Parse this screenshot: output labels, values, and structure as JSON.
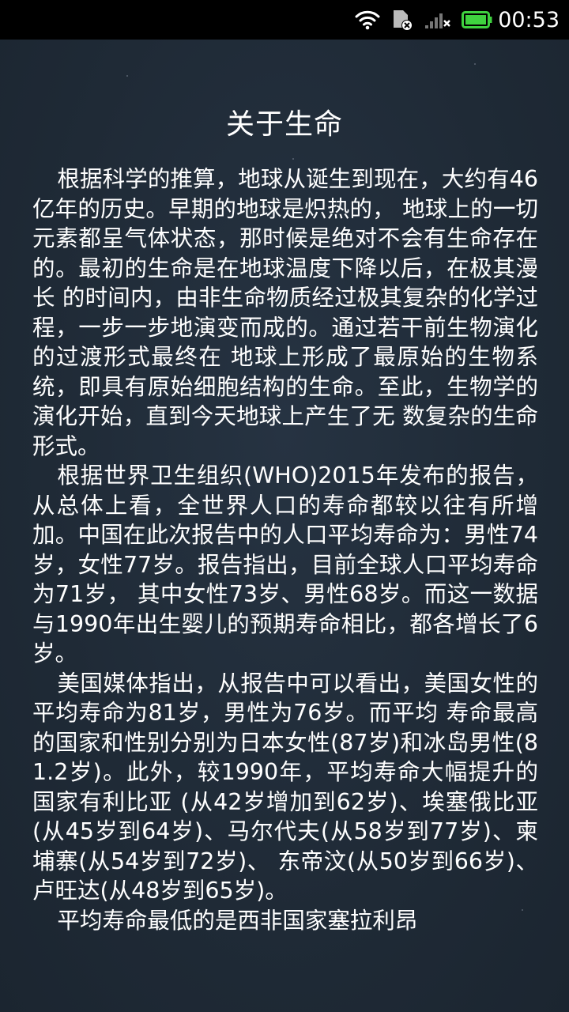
{
  "status_bar": {
    "time": "00:53",
    "icons": [
      "wifi-icon",
      "sim-card-disabled-icon",
      "signal-no-service-icon",
      "battery-icon"
    ],
    "battery_color": "#3fd23f"
  },
  "article": {
    "title": "关于生命",
    "paragraphs": [
      "根据科学的推算，地球从诞生到现在，大约有46亿年的历史。早期的地球是炽热的， 地球上的一切元素都呈气体状态，那时候是绝对不会有生命存在的。最初的生命是在地球温度下降以后，在极其漫长 的时间内，由非生命物质经过极其复杂的化学过程，一步一步地演变而成的。通过若干前生物演化的过渡形式最终在 地球上形成了最原始的生物系统，即具有原始细胞结构的生命。至此，生物学的演化开始，直到今天地球上产生了无 数复杂的生命形式。",
      "根据世界卫生组织(WHO)2015年发布的报告，从总体上看，全世界人口的寿命都较以往有所增加。中国在此次报告中的人口平均寿命为：男性74岁，女性77岁。报告指出，目前全球人口平均寿命为71岁， 其中女性73岁、男性68岁。而这一数据与1990年出生婴儿的预期寿命相比，都各增长了6岁。",
      "美国媒体指出，从报告中可以看出，美国女性的平均寿命为81岁，男性为76岁。而平均 寿命最高的国家和性别分别为日本女性(87岁)和冰岛男性(81.2岁)。此外，较1990年，平均寿命大幅提升的国家有利比亚 (从42岁增加到62岁)、埃塞俄比亚(从45岁到64岁)、马尔代夫(从58岁到77岁)、柬埔寨(从54岁到72岁)、 东帝汶(从50岁到66岁)、卢旺达(从48岁到65岁)。",
      "平均寿命最低的是西非国家塞拉利昂"
    ]
  }
}
